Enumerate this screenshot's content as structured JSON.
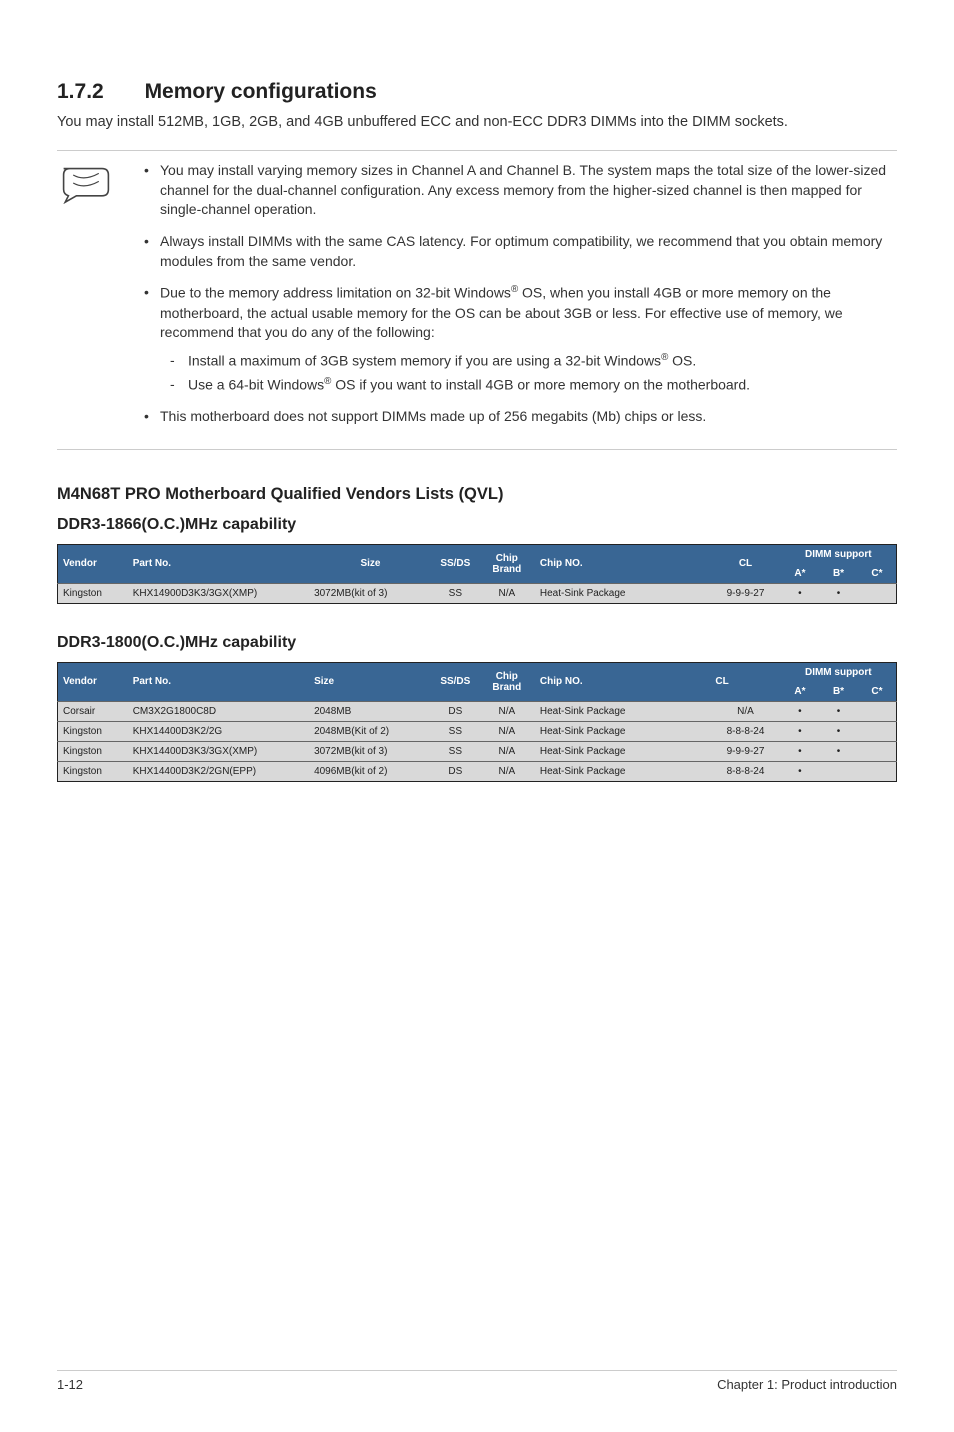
{
  "section": {
    "number": "1.7.2",
    "title": "Memory configurations",
    "intro": "You may install 512MB, 1GB, 2GB, and 4GB unbuffered ECC and non-ECC DDR3 DIMMs into the DIMM sockets."
  },
  "notes": {
    "bullet1": "You may install varying memory sizes in Channel A and Channel B. The system maps the total size of the lower-sized channel for the dual-channel configuration. Any excess memory from the higher-sized channel is then mapped for single-channel operation.",
    "bullet2": "Always install DIMMs with the same CAS latency. For optimum compatibility, we recommend that you obtain memory modules from the same vendor.",
    "bullet3_pre": "Due to the memory address limitation on 32-bit Windows",
    "bullet3_post": " OS, when you install 4GB or more memory on the motherboard, the actual usable memory for the OS can be about 3GB or less. For effective use of memory, we recommend that you do any of the following:",
    "sub1_pre": "Install a maximum of 3GB system memory if you are using a 32-bit Windows",
    "sub1_post": " OS.",
    "sub2_pre": "Use a 64-bit Windows",
    "sub2_post": " OS if you want to install 4GB or more memory on the motherboard.",
    "bullet4": "This motherboard does not support DIMMs made up of 256 megabits (Mb) chips or less.",
    "reg": "®"
  },
  "qvl": {
    "title": "M4N68T PRO Motherboard Qualified Vendors Lists (QVL)"
  },
  "headers": {
    "vendor": "Vendor",
    "part_no": "Part No.",
    "size": "Size",
    "ssds": "SS/DS",
    "chip_brand": "Chip Brand",
    "chip_no": "Chip NO.",
    "cl": "CL",
    "dimm_support": "DIMM support",
    "a": "A*",
    "b": "B*",
    "c": "C*"
  },
  "table1": {
    "title": "DDR3-1866(O.C.)MHz capability",
    "rows": [
      {
        "vendor": "Kingston",
        "part": "KHX14900D3K3/3GX(XMP)",
        "size": "3072MB(kit of 3)",
        "ssds": "SS",
        "brand": "N/A",
        "chipno": "Heat-Sink Package",
        "cl": "9-9-9-27",
        "a": "•",
        "b": "•",
        "c": ""
      }
    ]
  },
  "table2": {
    "title": "DDR3-1800(O.C.)MHz capability",
    "rows": [
      {
        "vendor": "Corsair",
        "part": "CM3X2G1800C8D",
        "size": "2048MB",
        "ssds": "DS",
        "brand": "N/A",
        "chipno": "Heat-Sink Package",
        "cl": "N/A",
        "a": "•",
        "b": "•",
        "c": ""
      },
      {
        "vendor": "Kingston",
        "part": "KHX14400D3K2/2G",
        "size": "2048MB(Kit of 2)",
        "ssds": "SS",
        "brand": "N/A",
        "chipno": "Heat-Sink Package",
        "cl": "8-8-8-24",
        "a": "•",
        "b": "•",
        "c": ""
      },
      {
        "vendor": "Kingston",
        "part": "KHX14400D3K3/3GX(XMP)",
        "size": "3072MB(kit of 3)",
        "ssds": "SS",
        "brand": "N/A",
        "chipno": "Heat-Sink Package",
        "cl": "9-9-9-27",
        "a": "•",
        "b": "•",
        "c": ""
      },
      {
        "vendor": "Kingston",
        "part": "KHX14400D3K2/2GN(EPP)",
        "size": "4096MB(kit of 2)",
        "ssds": "DS",
        "brand": "N/A",
        "chipno": "Heat-Sink Package",
        "cl": "8-8-8-24",
        "a": "•",
        "b": "",
        "c": ""
      }
    ]
  },
  "footer": {
    "page": "1-12",
    "chapter": "Chapter 1: Product introduction"
  }
}
